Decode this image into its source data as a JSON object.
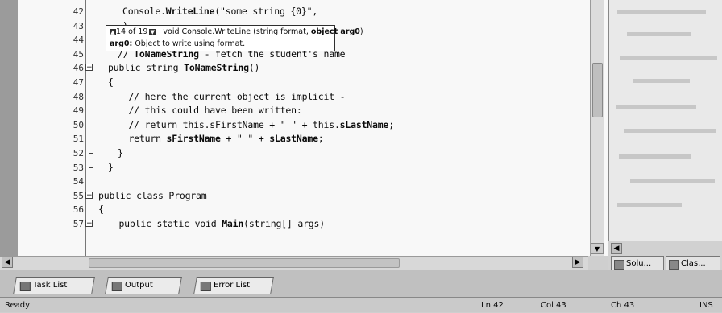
{
  "editor": {
    "lines": [
      {
        "num": "42",
        "code": "Console.WriteLine(\"some string {0}\","
      },
      {
        "num": "43",
        "code": ")"
      },
      {
        "num": "44",
        "code": ""
      },
      {
        "num": "45",
        "code": "// ToNameString - fetch the student's name"
      },
      {
        "num": "46",
        "code": "public string ToNameString()"
      },
      {
        "num": "47",
        "code": "{"
      },
      {
        "num": "48",
        "code": "  // here the current object is implicit -"
      },
      {
        "num": "49",
        "code": "  // this could have been written:"
      },
      {
        "num": "50",
        "code": "  // return this.sFirstName + \" \" + this.sLastName;"
      },
      {
        "num": "51",
        "code": "  return sFirstName + \" \" + sLastName;"
      },
      {
        "num": "52",
        "code": "}"
      },
      {
        "num": "53",
        "code": "}"
      },
      {
        "num": "54",
        "code": ""
      },
      {
        "num": "55",
        "code": "public class Program"
      },
      {
        "num": "56",
        "code": "{"
      },
      {
        "num": "57",
        "code": "  public static void Main(string[] args)"
      }
    ]
  },
  "tooltip": {
    "counter": "14 of 19",
    "signature_prefix": "void Console.WriteLine (string format, ",
    "signature_bold": "object arg0",
    "signature_suffix": ")",
    "param_name": "arg0:",
    "param_desc": " Object to write using format."
  },
  "right_tabs": [
    {
      "label": "Solu...",
      "icon": "solution-explorer-icon"
    },
    {
      "label": "Clas...",
      "icon": "class-view-icon"
    }
  ],
  "bottom_tabs": [
    {
      "label": "Task List",
      "icon": "task-list-icon"
    },
    {
      "label": "Output",
      "icon": "output-icon"
    },
    {
      "label": "Error List",
      "icon": "error-list-icon"
    }
  ],
  "status": {
    "text": "Ready",
    "line": "Ln 42",
    "col": "Col 43",
    "ch": "Ch 43",
    "mode": "INS"
  }
}
